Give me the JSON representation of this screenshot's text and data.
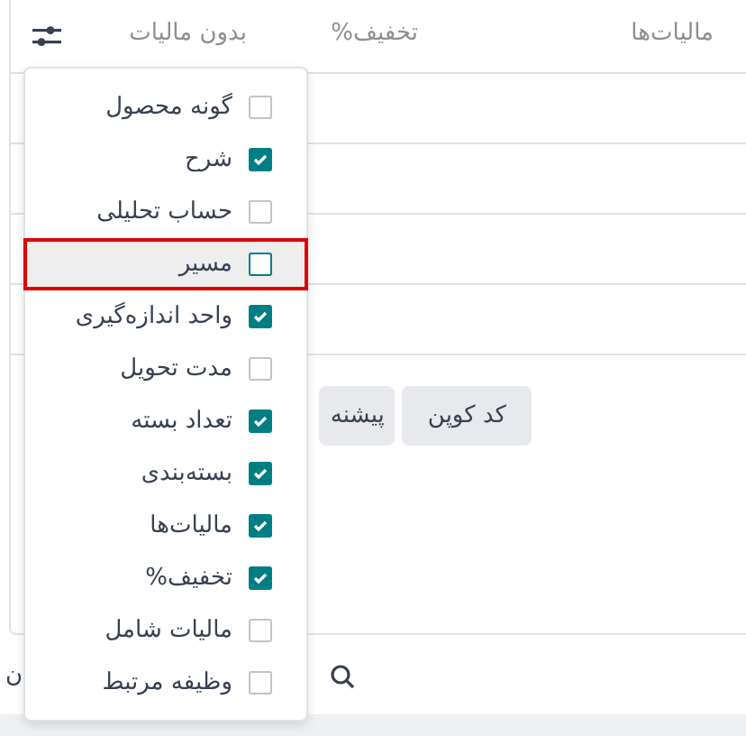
{
  "table": {
    "columns": [
      "مالیات‌ها",
      "تخفیف%",
      "بدون مالیات"
    ]
  },
  "buttons": [
    {
      "label": "کد کوپن"
    },
    {
      "label": "پیشنه"
    }
  ],
  "search_row": {
    "cut_text": "ن"
  },
  "column_menu": {
    "items": [
      {
        "label": "گونه محصول",
        "checked": false,
        "highlighted": false
      },
      {
        "label": "شرح",
        "checked": true,
        "highlighted": false
      },
      {
        "label": "حساب تحلیلی",
        "checked": false,
        "highlighted": false
      },
      {
        "label": "مسیر",
        "checked": false,
        "highlighted": true
      },
      {
        "label": "واحد اندازه‌گیری",
        "checked": true,
        "highlighted": false
      },
      {
        "label": "مدت تحویل",
        "checked": false,
        "highlighted": false
      },
      {
        "label": "تعداد بسته",
        "checked": true,
        "highlighted": false
      },
      {
        "label": "بسته‌بندی",
        "checked": true,
        "highlighted": false
      },
      {
        "label": "مالیات‌ها",
        "checked": true,
        "highlighted": false
      },
      {
        "label": "تخفیف%",
        "checked": true,
        "highlighted": false
      },
      {
        "label": "مالیات شامل",
        "checked": false,
        "highlighted": false
      },
      {
        "label": "وظیفه مرتبط",
        "checked": false,
        "highlighted": false
      }
    ]
  }
}
